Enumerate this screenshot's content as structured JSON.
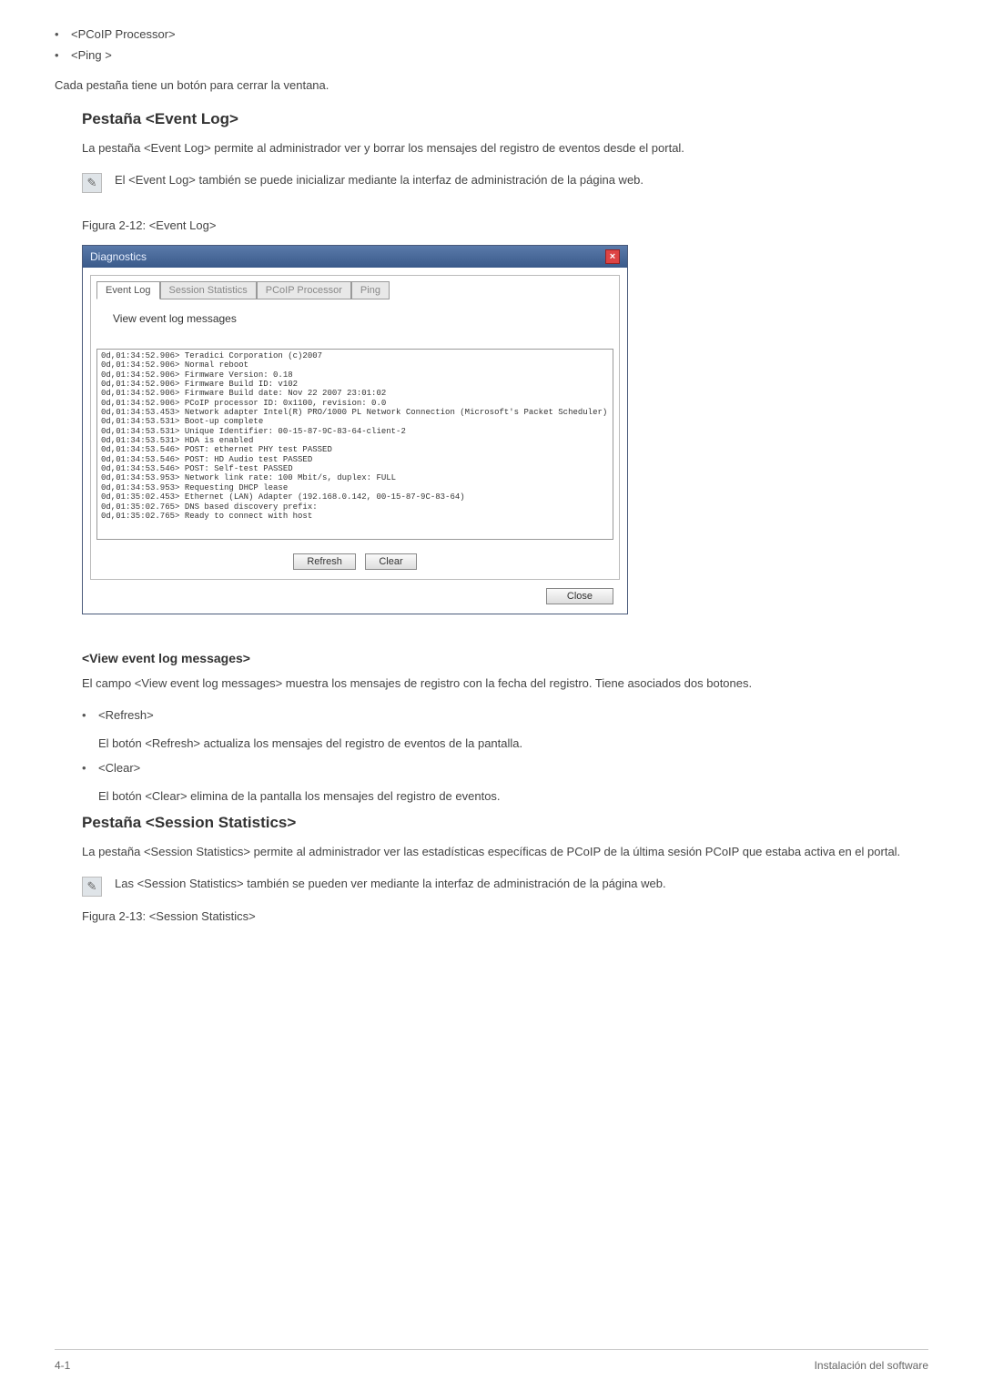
{
  "top_bullets": [
    "<PCoIP Processor>",
    "<Ping >"
  ],
  "para_close_tabs": "Cada pestaña tiene un botón para cerrar la ventana.",
  "event_log": {
    "heading": "Pestaña <Event Log>",
    "desc": "La pestaña <Event Log> permite al administrador ver y borrar los mensajes del registro de eventos desde el portal.",
    "note": "El <Event Log> también se puede inicializar mediante la interfaz de administración de la página web.",
    "caption": "Figura 2-12: <Event Log>"
  },
  "dialog": {
    "title": "Diagnostics",
    "tabs": [
      "Event Log",
      "Session Statistics",
      "PCoIP Processor",
      "Ping"
    ],
    "view_label": "View event log messages",
    "log_lines": [
      "0d,01:34:52.906> Teradici Corporation (c)2007",
      "0d,01:34:52.906> Normal reboot",
      "0d,01:34:52.906> Firmware Version: 0.18",
      "0d,01:34:52.906> Firmware Build ID: v102",
      "0d,01:34:52.906> Firmware Build date: Nov 22 2007 23:01:02",
      "0d,01:34:52.906> PCoIP processor ID: 0x1100, revision: 0.0",
      "0d,01:34:53.453> Network adapter Intel(R) PRO/1000 PL Network Connection (Microsoft's Packet Scheduler)",
      "0d,01:34:53.531> Boot-up complete",
      "0d,01:34:53.531> Unique Identifier: 00-15-87-9C-83-64-client-2",
      "0d,01:34:53.531> HDA is enabled",
      "0d,01:34:53.546> POST: ethernet PHY test PASSED",
      "0d,01:34:53.546> POST: HD Audio test PASSED",
      "0d,01:34:53.546> POST: Self-test PASSED",
      "0d,01:34:53.953> Network link rate: 100 Mbit/s, duplex: FULL",
      "0d,01:34:53.953> Requesting DHCP lease",
      "0d,01:35:02.453> Ethernet (LAN) Adapter (192.168.0.142, 00-15-87-9C-83-64)",
      "0d,01:35:02.765> DNS based discovery prefix:",
      "0d,01:35:02.765> Ready to connect with host"
    ],
    "refresh": "Refresh",
    "clear": "Clear",
    "close": "Close"
  },
  "view_section": {
    "heading": "<View event log messages>",
    "desc": "El campo <View event log messages> muestra los mensajes de registro con la fecha del registro. Tiene asociados dos botones.",
    "items": [
      {
        "label": "<Refresh>",
        "desc": "El botón <Refresh> actualiza los mensajes del registro de eventos de la pantalla."
      },
      {
        "label": "<Clear>",
        "desc": "El botón <Clear> elimina de la pantalla los mensajes del registro de eventos."
      }
    ]
  },
  "session": {
    "heading": "Pestaña <Session Statistics>",
    "desc": "La pestaña <Session Statistics> permite al administrador ver las estadísticas específicas de PCoIP de la última sesión PCoIP que estaba activa en el portal.",
    "note": "Las <Session Statistics> también se pueden ver mediante la interfaz de administración de la página web.",
    "caption": "Figura 2-13: <Session Statistics>"
  },
  "footer": {
    "left": "4-1",
    "right": "Instalación del software"
  }
}
